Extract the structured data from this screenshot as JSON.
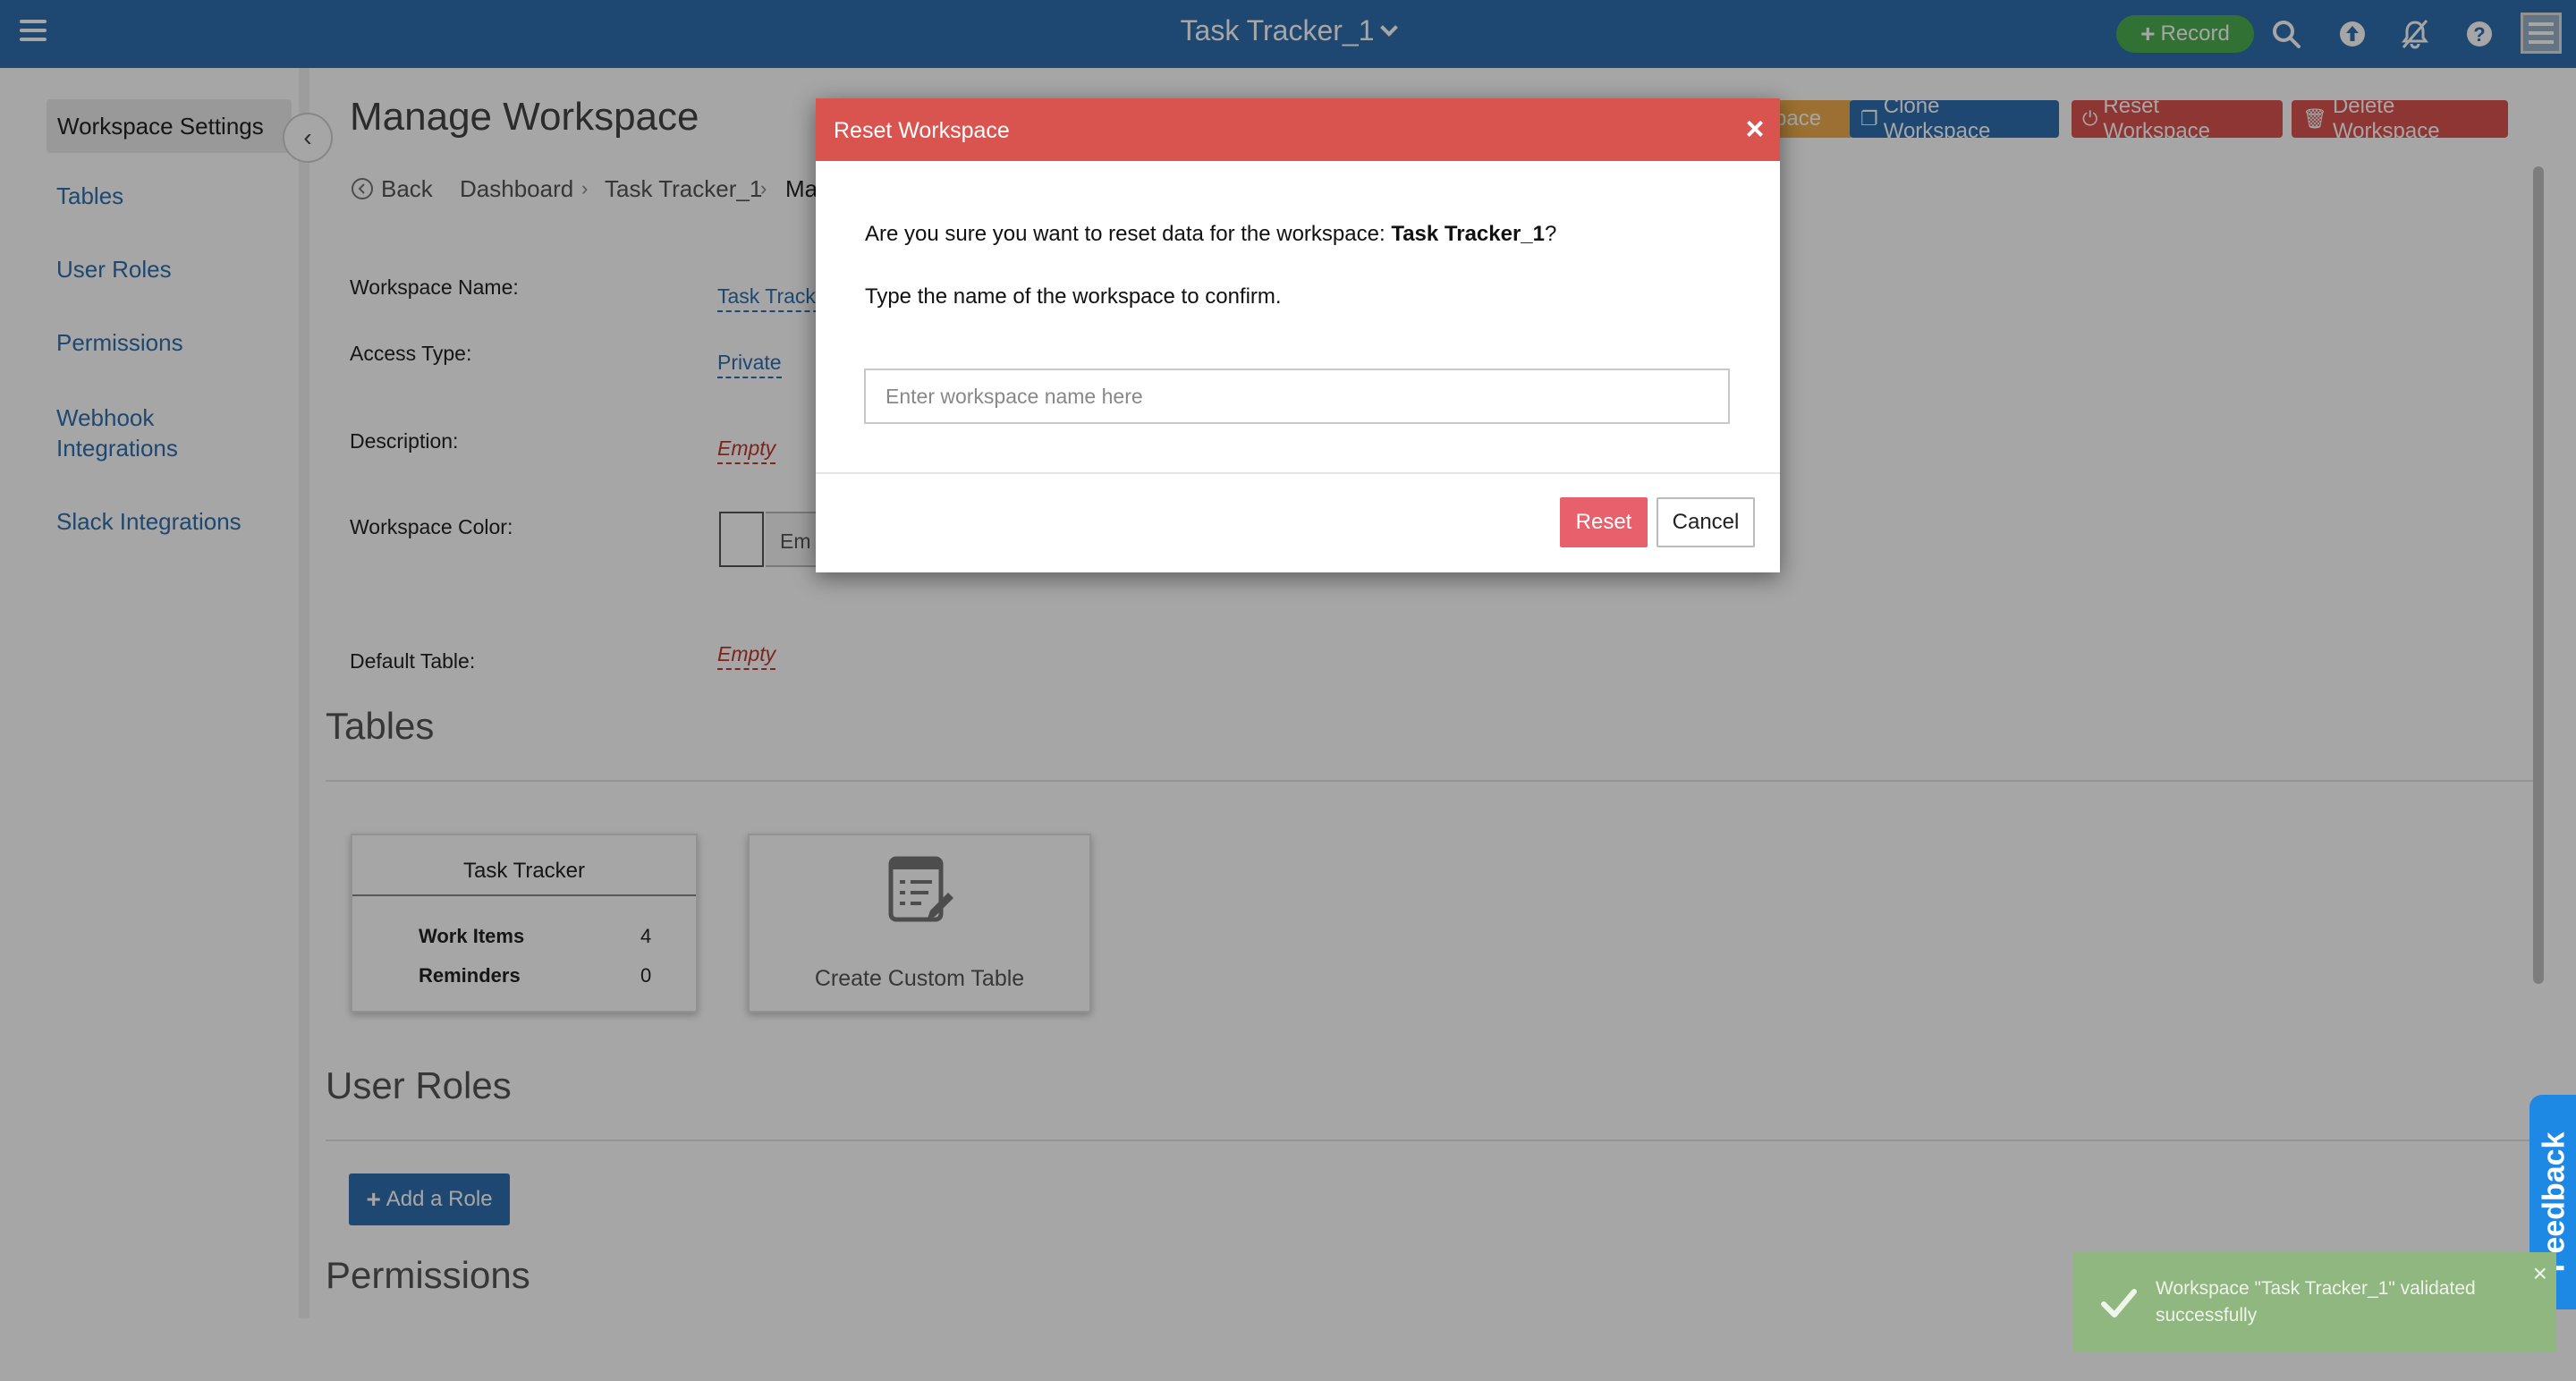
{
  "header": {
    "app_title": "Task Tracker_1",
    "record_label": "Record"
  },
  "sidebar": {
    "active_item": "Workspace Settings",
    "items": [
      {
        "label": "Tables"
      },
      {
        "label": "User Roles"
      },
      {
        "label": "Permissions"
      },
      {
        "label": "Webhook Integrations"
      },
      {
        "label": "Slack Integrations"
      }
    ],
    "collapse_icon": "chevron-left-icon"
  },
  "main": {
    "page_title": "Manage Workspace",
    "breadcrumb": {
      "back": "Back",
      "items": [
        "Dashboard",
        "Task Tracker_1",
        "Ma"
      ]
    },
    "actions": {
      "partial_label": "pace",
      "clone": "Clone Workspace",
      "reset": "Reset Workspace",
      "delete": "Delete Workspace"
    },
    "fields": {
      "workspace_name_label": "Workspace Name:",
      "workspace_name_value": "Task Tracke",
      "access_type_label": "Access Type:",
      "access_type_value": "Private",
      "description_label": "Description:",
      "description_value": "Empty",
      "color_label": "Workspace Color:",
      "color_value": "Em",
      "default_table_label": "Default Table:",
      "default_table_value": "Empty"
    },
    "sections": {
      "tables": "Tables",
      "user_roles": "User Roles",
      "permissions": "Permissions"
    },
    "table_card": {
      "title": "Task Tracker",
      "rows": [
        {
          "label": "Work Items",
          "value": "4"
        },
        {
          "label": "Reminders",
          "value": "0"
        }
      ]
    },
    "create_card": {
      "label": "Create Custom Table"
    },
    "add_role_label": "Add a Role"
  },
  "modal": {
    "title": "Reset Workspace",
    "text_prefix": "Are you sure you want to reset data for the workspace: ",
    "workspace_name": "Task Tracker_1",
    "text_suffix": "?",
    "instruction": "Type the name of the workspace to confirm.",
    "input_value": "",
    "input_placeholder": "Enter workspace name here",
    "reset_label": "Reset",
    "cancel_label": "Cancel"
  },
  "feedback_label": "Feedback",
  "toast": {
    "message": "Workspace \"Task Tracker_1\" validated successfully"
  },
  "colors": {
    "topbar": "#2f6fae",
    "modal_header": "#d9534f",
    "reset_button": "#e8606b",
    "record_button": "#4caf50",
    "toast": "#8fb77f",
    "feedback": "#1e88e5"
  }
}
